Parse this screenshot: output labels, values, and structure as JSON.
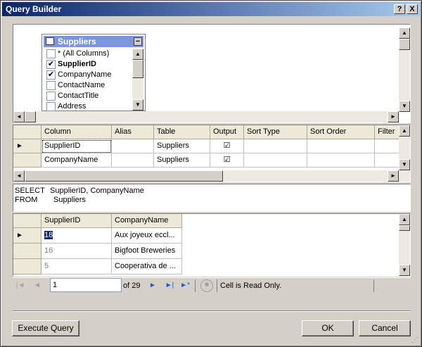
{
  "window": {
    "title": "Query Builder"
  },
  "titlebar_buttons": {
    "help": "?",
    "close": "X"
  },
  "diagram": {
    "table_name": "Suppliers",
    "columns": [
      {
        "label": "* (All Columns)",
        "checked": false,
        "bold": false
      },
      {
        "label": "SupplierID",
        "checked": true,
        "bold": true
      },
      {
        "label": "CompanyName",
        "checked": true,
        "bold": false
      },
      {
        "label": "ContactName",
        "checked": false,
        "bold": false
      },
      {
        "label": "ContactTitle",
        "checked": false,
        "bold": false
      },
      {
        "label": "Address",
        "checked": false,
        "bold": false
      }
    ]
  },
  "criteria": {
    "headers": [
      "Column",
      "Alias",
      "Table",
      "Output",
      "Sort Type",
      "Sort Order",
      "Filter"
    ],
    "rows": [
      {
        "column": "SupplierID",
        "alias": "",
        "table": "Suppliers",
        "output": "☑"
      },
      {
        "column": "CompanyName",
        "alias": "",
        "table": "Suppliers",
        "output": "☑"
      }
    ]
  },
  "sql": {
    "line1_keyword": "SELECT",
    "line1_value": "SupplierID, CompanyName",
    "line2_keyword": "FROM",
    "line2_value": "Suppliers"
  },
  "results": {
    "headers": [
      "SupplierID",
      "CompanyName"
    ],
    "rows": [
      {
        "id": "18",
        "name": "Aux joyeux eccl..."
      },
      {
        "id": "16",
        "name": "Bigfoot Breweries"
      },
      {
        "id": "5",
        "name": "Cooperativa de ..."
      }
    ]
  },
  "navigator": {
    "record": "1",
    "of_text": "of 29",
    "status": "Cell is Read Only."
  },
  "buttons": {
    "execute": "Execute Query",
    "ok": "OK",
    "cancel": "Cancel"
  },
  "colors": {
    "title_gradient_start": "#0a246a",
    "title_gradient_end": "#a6caf0",
    "selected_cell": "#0a246a",
    "nav_arrow": "#1e5ad6"
  }
}
